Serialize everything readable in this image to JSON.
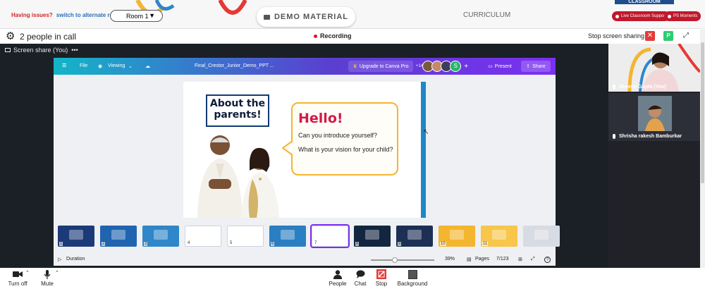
{
  "topbar": {
    "issues_text": "Having issues?",
    "switch_link": "switch to alternate room",
    "room_value": "Room 1",
    "demo_tab": "DEMO MATERIAL",
    "curriculum_tab": "CURRICULUM",
    "classroom_tab": "CLASSROOM",
    "live_support": "Live Classroom Support",
    "ps_moments": "PS Moments"
  },
  "call": {
    "people_count": "2 people in call",
    "recording": "Recording",
    "stop_sharing": "Stop screen sharing",
    "close_symbol": "✕",
    "p_badge": "P",
    "share_label": "Screen share (You)",
    "more_dots": "•••"
  },
  "canva": {
    "menu_icon": "≡",
    "file": "File",
    "viewing": "Viewing",
    "doc_title": "Final_Crestor_Junior_Demo_PPT ...",
    "upgrade": "Upgrade to Canva Pro",
    "collab_count": "+14",
    "avatar_s": "S",
    "present": "Present",
    "share": "Share",
    "slide_title": "About the parents!",
    "hello": "Hello!",
    "question1": "Can you introduce yourself?",
    "question2": "What is your vision for your child?",
    "thumbnails": [
      {
        "num": "1",
        "bg": "#1b3a78"
      },
      {
        "num": "2",
        "bg": "#2064b0"
      },
      {
        "num": "3",
        "bg": "#2f86c9"
      },
      {
        "num": "4",
        "bg": "#ffffff"
      },
      {
        "num": "5",
        "bg": "#ffffff"
      },
      {
        "num": "6",
        "bg": "#2a7fc2"
      },
      {
        "num": "7",
        "bg": "#ffffff"
      },
      {
        "num": "8",
        "bg": "#12263f"
      },
      {
        "num": "9",
        "bg": "#1d2f55"
      },
      {
        "num": "10",
        "bg": "#f4b52f"
      },
      {
        "num": "11",
        "bg": "#f7c64a"
      },
      {
        "num": "",
        "bg": "#d7dbe3"
      }
    ],
    "duration": "Duration",
    "zoom": "39%",
    "pages": "Pages",
    "page_counter": "7/123",
    "help": "?"
  },
  "participants": [
    {
      "name": "Sheenu Gupta (You)"
    },
    {
      "name": "Shrisha rakesh Bamburkar"
    }
  ],
  "toolbar": {
    "turn_off": "Turn off",
    "mute": "Mute",
    "people": "People",
    "chat": "Chat",
    "stop": "Stop",
    "background": "Background"
  }
}
